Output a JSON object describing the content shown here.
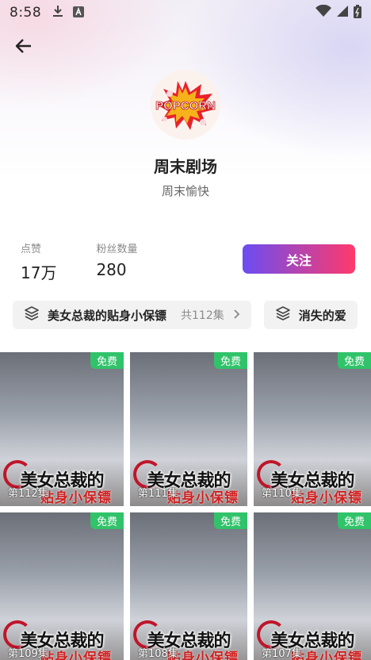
{
  "status_bar": {
    "time": "8:58"
  },
  "channel": {
    "avatar_text": "POPCORN",
    "name": "周末剧场",
    "subtitle": "周末愉快"
  },
  "stats": [
    {
      "label": "点赞",
      "value": "17万"
    },
    {
      "label": "粉丝数量",
      "value": "280"
    }
  ],
  "follow_label": "关注",
  "collections": [
    {
      "title": "美女总裁的贴身小保镖",
      "count": "共112集"
    },
    {
      "title": "消失的爱"
    }
  ],
  "episodes": [
    {
      "badge": "免费",
      "label": "第112集"
    },
    {
      "badge": "免费",
      "label": "第111集"
    },
    {
      "badge": "免费",
      "label": "第110集"
    },
    {
      "badge": "免费",
      "label": "第109集"
    },
    {
      "badge": "免费",
      "label": "第108集"
    },
    {
      "badge": "免费",
      "label": "第107集"
    }
  ],
  "poster": {
    "title": "美女总裁的",
    "subtitle": "贴身小保镖"
  },
  "colors": {
    "follow_gradient_start": "#6a4df2",
    "follow_gradient_end": "#ff3a6b",
    "free_badge": "#31c36a"
  }
}
